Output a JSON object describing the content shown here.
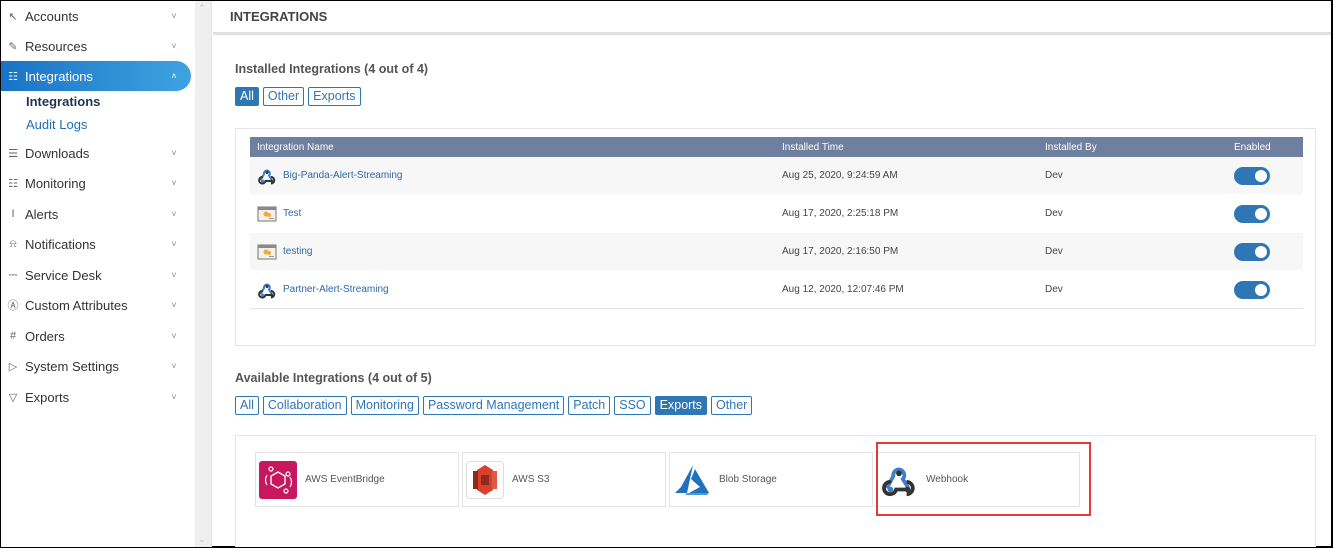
{
  "sidebar": {
    "items": [
      {
        "label": "Accounts",
        "icon": "cursor-icon",
        "glyph": "↖",
        "chevron": "⌄"
      },
      {
        "label": "Resources",
        "icon": "pencil-icon",
        "glyph": "✎",
        "chevron": "⌄"
      },
      {
        "label": "Integrations",
        "icon": "document-icon",
        "glyph": "☷",
        "chevron": "⌃",
        "active": true
      },
      {
        "label": "Downloads",
        "icon": "list-icon",
        "glyph": "☰",
        "chevron": "⌄"
      },
      {
        "label": "Monitoring",
        "icon": "clipboard-icon",
        "glyph": "☷",
        "chevron": "⌄"
      },
      {
        "label": "Alerts",
        "icon": "text-cursor-icon",
        "glyph": "I",
        "chevron": "⌄"
      },
      {
        "label": "Notifications",
        "icon": "bell-icon",
        "glyph": "⍾",
        "chevron": "⌄"
      },
      {
        "label": "Service Desk",
        "icon": "pin-icon",
        "glyph": "⎓",
        "chevron": "⌄"
      },
      {
        "label": "Custom Attributes",
        "icon": "attribute-icon",
        "glyph": "Ⓐ",
        "chevron": "⌄"
      },
      {
        "label": "Orders",
        "icon": "hash-icon",
        "glyph": "#",
        "chevron": "⌄"
      },
      {
        "label": "System Settings",
        "icon": "play-box-icon",
        "glyph": "▷",
        "chevron": "⌄"
      },
      {
        "label": "Exports",
        "icon": "export-icon",
        "glyph": "▽",
        "chevron": "⌄"
      }
    ],
    "sub_items": [
      {
        "label": "Integrations",
        "current": true
      },
      {
        "label": "Audit Logs"
      }
    ]
  },
  "header": {
    "title": "INTEGRATIONS"
  },
  "installed": {
    "title": "Installed Integrations (4 out of 4)",
    "filters": [
      {
        "label": "All",
        "selected": true
      },
      {
        "label": "Other"
      },
      {
        "label": "Exports"
      }
    ],
    "columns": [
      "Integration Name",
      "Installed Time",
      "Installed By",
      "Enabled"
    ],
    "rows": [
      {
        "name": "Big-Panda-Alert-Streaming",
        "icon": "webhook",
        "time": "Aug 25, 2020, 9:24:59 AM",
        "by": "Dev",
        "enabled": true
      },
      {
        "name": "Test",
        "icon": "browser",
        "time": "Aug 17, 2020, 2:25:18 PM",
        "by": "Dev",
        "enabled": true
      },
      {
        "name": "testing",
        "icon": "browser",
        "time": "Aug 17, 2020, 2:16:50 PM",
        "by": "Dev",
        "enabled": true
      },
      {
        "name": "Partner-Alert-Streaming",
        "icon": "webhook",
        "time": "Aug 12, 2020, 12:07:46 PM",
        "by": "Dev",
        "enabled": true
      }
    ]
  },
  "available": {
    "title": "Available Integrations (4 out of 5)",
    "filters": [
      {
        "label": "All"
      },
      {
        "label": "Collaboration"
      },
      {
        "label": "Monitoring"
      },
      {
        "label": "Password Management"
      },
      {
        "label": "Patch"
      },
      {
        "label": "SSO"
      },
      {
        "label": "Exports",
        "selected": true
      },
      {
        "label": "Other"
      }
    ],
    "cards": [
      {
        "label": "AWS EventBridge",
        "icon": "eventbridge"
      },
      {
        "label": "AWS S3",
        "icon": "s3"
      },
      {
        "label": "Blob Storage",
        "icon": "azure"
      },
      {
        "label": "Webhook",
        "icon": "webhook",
        "highlighted": true
      }
    ]
  },
  "colors": {
    "accent": "#2f76b5",
    "table_header": "#6f7f9f",
    "highlight": "#e23b3b",
    "eventbridge": "#c7175e",
    "s3": "#d9412e",
    "azure": "#1f72bd"
  }
}
